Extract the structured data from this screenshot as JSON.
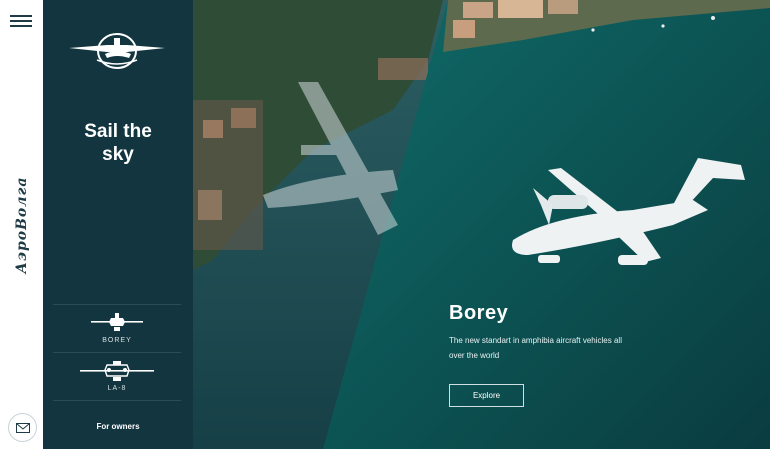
{
  "rail": {
    "menu_icon": "hamburger-icon",
    "brand_name": "АэроВолга",
    "mail_icon": "envelope-icon"
  },
  "panel": {
    "logo_icon": "airplane-emblem-icon",
    "tagline_line1": "Sail the",
    "tagline_line2": "sky",
    "models": [
      {
        "label": "BOREY",
        "icon": "borey-plane-icon"
      },
      {
        "label": "LA-8",
        "icon": "la8-plane-icon"
      }
    ],
    "owners_link": "For owners"
  },
  "hero": {
    "title": "Borey",
    "subtitle": "The new standart in amphibia aircraft vehicles all over the world",
    "cta": "Explore"
  },
  "colors": {
    "panel_bg": "#123540",
    "rail_bg": "#ffffff",
    "water": "#0f4f52",
    "accent_text": "#ffffff"
  }
}
